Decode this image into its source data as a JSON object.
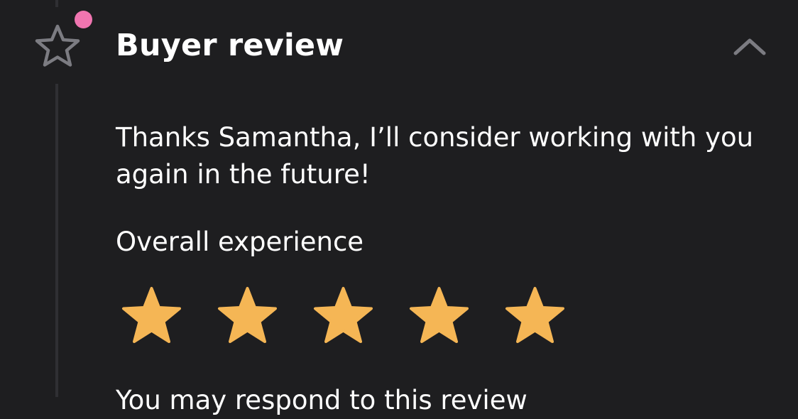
{
  "header": {
    "title": "Buyer review",
    "icon": "star-outline-icon",
    "notification_color": "#f075b0",
    "collapse_icon": "chevron-up-icon"
  },
  "review": {
    "text": "Thanks Samantha, I’ll consider working with you again in the future!",
    "rating_label": "Overall experience",
    "rating": 5,
    "rating_max": 5,
    "star_color": "#f5b655",
    "respond_text": "You may respond to this review"
  }
}
